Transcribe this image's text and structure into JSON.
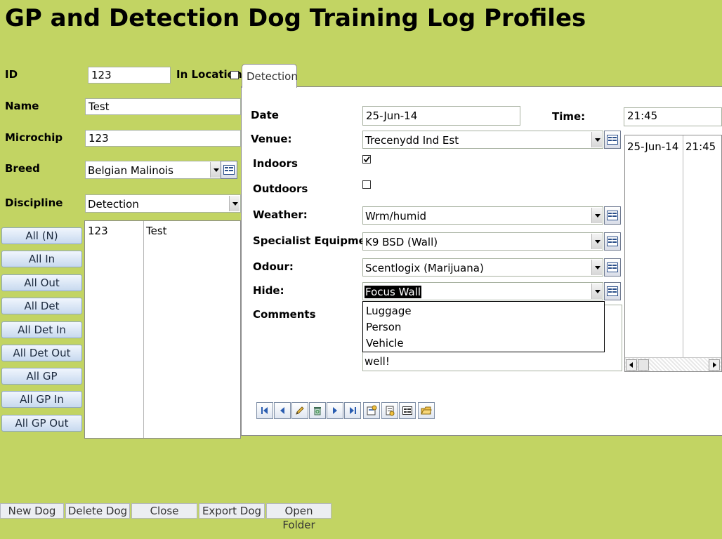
{
  "window": {
    "title": "GP and Detection Dog Training Log Profiles"
  },
  "profile": {
    "id_label": "ID",
    "id_value": "123",
    "in_location_label": "In Location",
    "in_location_checked": false,
    "name_label": "Name",
    "name_value": "Test",
    "microchip_label": "Microchip",
    "microchip_value": "123",
    "breed_label": "Breed",
    "breed_value": "Belgian Malinois",
    "discipline_label": "Discipline",
    "discipline_value": "Detection"
  },
  "filters": [
    "All (N)",
    "All In",
    "All Out",
    "All Det",
    "All Det In",
    "All Det Out",
    "All GP",
    "All GP In",
    "All GP Out"
  ],
  "dog_list": {
    "rows": [
      {
        "id": "123",
        "name": "Test"
      }
    ]
  },
  "tabs": [
    {
      "label": "Detection",
      "active": true
    }
  ],
  "detection": {
    "date_label": "Date",
    "date_value": "25-Jun-14",
    "time_label": "Time:",
    "time_value": "21:45",
    "venue_label": "Venue:",
    "venue_value": "Trecenydd Ind Est",
    "indoors_label": "Indoors",
    "indoors_checked": true,
    "outdoors_label": "Outdoors",
    "outdoors_checked": false,
    "weather_label": "Weather:",
    "weather_value": "Wrm/humid",
    "equipment_label": "Specialist Equipment:",
    "equipment_value": "K9 BSD (Wall)",
    "odour_label": "Odour:",
    "odour_value": "Scentlogix (Marijuana)",
    "hide_label": "Hide:",
    "hide_value": "Focus Wall",
    "hide_options": [
      "Luggage",
      "Person",
      "Vehicle"
    ],
    "comments_label": "Comments",
    "comments_value": "well!"
  },
  "history_list": {
    "rows": [
      {
        "date": "25-Jun-14",
        "time": "21:45"
      }
    ]
  },
  "bottom_buttons": [
    "New Dog",
    "Delete Dog",
    "Close",
    "Export Dog",
    "Open Folder"
  ],
  "colors": {
    "background": "#c2d463",
    "button_fill": "#c7d9ef",
    "selection": "#000000"
  }
}
